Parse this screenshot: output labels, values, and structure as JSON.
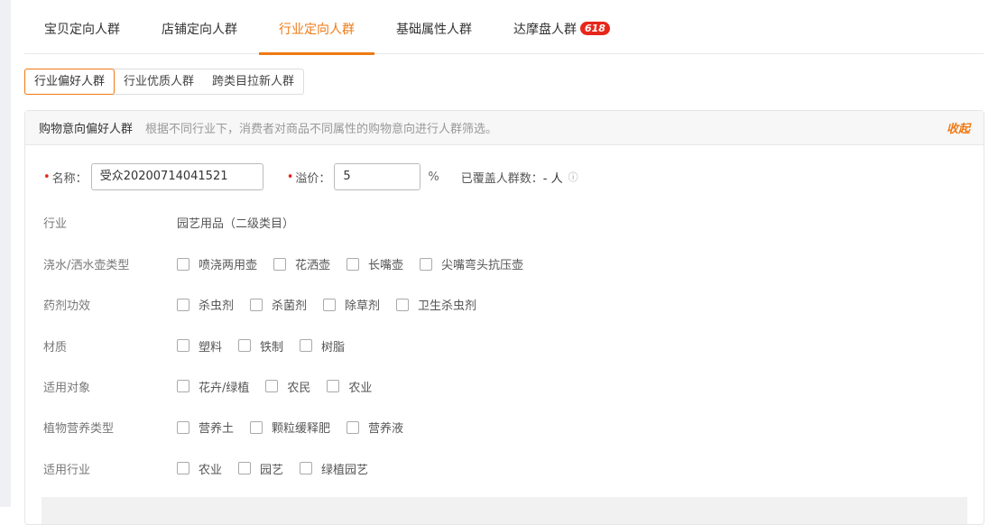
{
  "tabs": [
    {
      "label": "宝贝定向人群"
    },
    {
      "label": "店铺定向人群"
    },
    {
      "label": "行业定向人群"
    },
    {
      "label": "基础属性人群"
    },
    {
      "label": "达摩盘人群",
      "badge": "618"
    }
  ],
  "subtabs": [
    {
      "label": "行业偏好人群"
    },
    {
      "label": "行业优质人群"
    },
    {
      "label": "跨类目拉新人群"
    }
  ],
  "panel": {
    "title": "购物意向偏好人群",
    "desc": "根据不同行业下，消费者对商品不同属性的购物意向进行人群筛选。",
    "collapse": "收起"
  },
  "form": {
    "name_label": "名称：",
    "name_value": "受众20200714041521",
    "premium_label": "溢价：",
    "premium_value": "5",
    "percent": "%",
    "coverage_label": "已覆盖人群数：",
    "coverage_value": "- 人",
    "info_icon": "ⓘ"
  },
  "industry": {
    "label": "行业",
    "value": "园艺用品（二级类目）"
  },
  "rows": [
    {
      "label": "浇水/洒水壶类型",
      "options": [
        "喷浇两用壶",
        "花洒壶",
        "长嘴壶",
        "尖嘴弯头抗压壶"
      ]
    },
    {
      "label": "药剂功效",
      "options": [
        "杀虫剂",
        "杀菌剂",
        "除草剂",
        "卫生杀虫剂"
      ]
    },
    {
      "label": "材质",
      "options": [
        "塑料",
        "铁制",
        "树脂"
      ]
    },
    {
      "label": "适用对象",
      "options": [
        "花卉/绿植",
        "农民",
        "农业"
      ]
    },
    {
      "label": "植物营养类型",
      "options": [
        "营养土",
        "颗粒缓释肥",
        "营养液"
      ]
    },
    {
      "label": "适用行业",
      "options": [
        "农业",
        "园艺",
        "绿植园艺"
      ]
    }
  ]
}
